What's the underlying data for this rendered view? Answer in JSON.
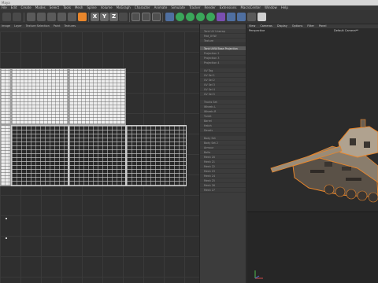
{
  "window": {
    "title": "Maya"
  },
  "menubar": {
    "items": [
      "File",
      "Edit",
      "Create",
      "Modes",
      "Select",
      "Tools",
      "Mesh",
      "Spline",
      "Volume",
      "MoGraph",
      "Character",
      "Animate",
      "Simulate",
      "Tracker",
      "Render",
      "Extensions",
      "MacroCenter",
      "Window",
      "Help"
    ]
  },
  "uv_editor": {
    "toolbar_items": [
      "Image",
      "Layer",
      "Texture Selection",
      "Paint",
      "Textures"
    ]
  },
  "texture_panel": {
    "items": [
      "Tank UV Unwrap",
      "Mat_UVW",
      "Texture",
      "Tank UVW Base Projection",
      "Projection 2",
      "Projection 3",
      "Projection 4",
      "UV Tag",
      "UV Sel 1",
      "UV Sel 2",
      "UV Sel 3",
      "UV Sel 4",
      "UV Sel 5",
      "Tracks Set",
      "Wheels L",
      "Wheels R",
      "Turret",
      "Barrel",
      "Hatch",
      "Decals",
      "Body Set",
      "Body Set 2",
      "Armour",
      "Bolts",
      "Mesh 20",
      "Mesh 21",
      "Mesh 22",
      "Mesh 23",
      "Mesh 24",
      "Mesh 25",
      "Mesh 26",
      "Mesh 27"
    ],
    "active_index": 3
  },
  "viewport": {
    "menu_items": [
      "View",
      "Cameras",
      "Display",
      "Options",
      "Filter",
      "Panel"
    ],
    "mode_label": "Perspective",
    "camera_label": "Default Camera**"
  },
  "colors": {
    "accent": "#e9862b",
    "selection_outline": "#e9862b"
  }
}
